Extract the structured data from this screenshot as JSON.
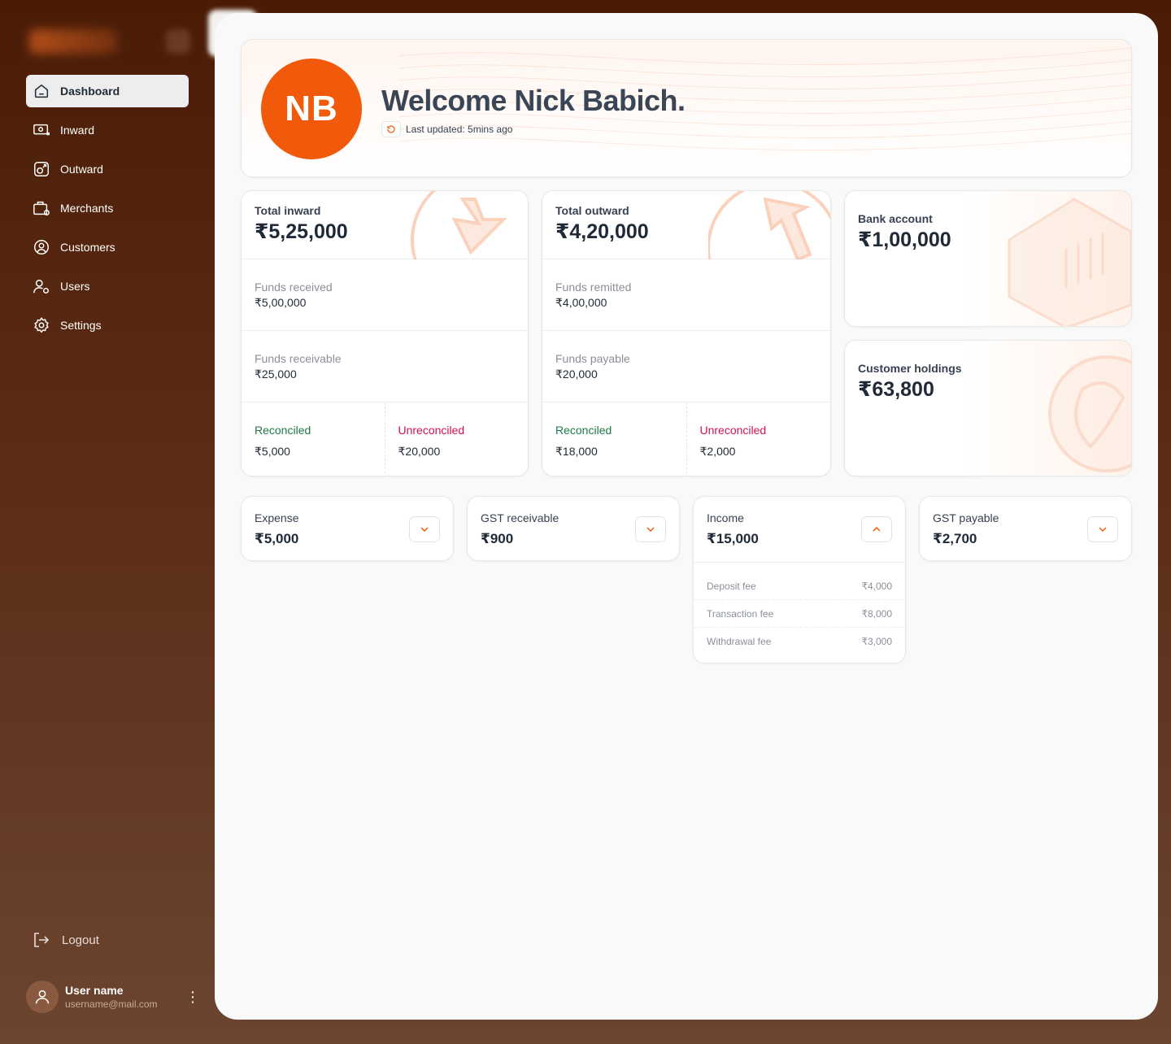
{
  "nav": {
    "items": [
      {
        "label": "Dashboard",
        "icon": "home-icon",
        "active": true
      },
      {
        "label": "Inward",
        "icon": "inward-icon"
      },
      {
        "label": "Outward",
        "icon": "outward-icon"
      },
      {
        "label": "Merchants",
        "icon": "merchants-icon"
      },
      {
        "label": "Customers",
        "icon": "customers-icon"
      },
      {
        "label": "Users",
        "icon": "users-icon"
      },
      {
        "label": "Settings",
        "icon": "gear-icon"
      }
    ],
    "logout_label": "Logout"
  },
  "user": {
    "name": "User name",
    "email": "username@mail.com"
  },
  "welcome": {
    "initials": "NB",
    "title": "Welcome Nick Babich.",
    "updated": "Last updated: 5mins ago"
  },
  "inward": {
    "title": "Total inward",
    "total": "₹5,25,000",
    "received_label": "Funds received",
    "received": "₹5,00,000",
    "receivable_label": "Funds receivable",
    "receivable": "₹25,000",
    "reconciled_label": "Reconciled",
    "reconciled": "₹5,000",
    "unreconciled_label": "Unreconciled",
    "unreconciled": "₹20,000"
  },
  "outward": {
    "title": "Total outward",
    "total": "₹4,20,000",
    "remitted_label": "Funds remitted",
    "remitted": "₹4,00,000",
    "payable_label": "Funds payable",
    "payable": "₹20,000",
    "reconciled_label": "Reconciled",
    "reconciled": "₹18,000",
    "unreconciled_label": "Unreconciled",
    "unreconciled": "₹2,000"
  },
  "bank": {
    "title": "Bank account",
    "value": "₹1,00,000"
  },
  "holdings": {
    "title": "Customer holdings",
    "value": "₹63,800"
  },
  "mini": {
    "expense": {
      "label": "Expense",
      "value": "₹5,000"
    },
    "gst_receivable": {
      "label": "GST receivable",
      "value": "₹900"
    },
    "income": {
      "label": "Income",
      "value": "₹15,000",
      "rows": [
        {
          "label": "Deposit fee",
          "value": "₹4,000"
        },
        {
          "label": "Transaction fee",
          "value": "₹8,000"
        },
        {
          "label": "Withdrawal fee",
          "value": "₹3,000"
        }
      ]
    },
    "gst_payable": {
      "label": "GST payable",
      "value": "₹2,700"
    }
  },
  "colors": {
    "accent": "#f05a0a",
    "reconciled": "#1e7a45",
    "unreconciled": "#d1104f"
  }
}
